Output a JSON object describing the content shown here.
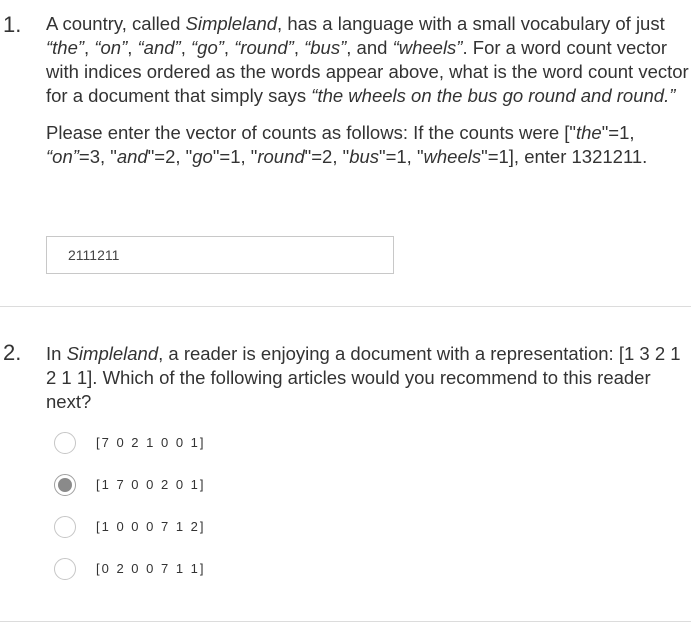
{
  "questions": [
    {
      "number": "1.",
      "prompt": {
        "t1": "A country, called ",
        "t2": "Simpleland",
        "t3": ", has a language with a small vocabulary of just ",
        "t4": "“the”",
        "t5": ", ",
        "t6": "“on”",
        "t7": ", ",
        "t8": "“and”",
        "t9": ", ",
        "t10": "“go”",
        "t11": ", ",
        "t12": "“round”",
        "t13": ", ",
        "t14": "“bus”",
        "t15": ", and ",
        "t16": "“wheels”",
        "t17": ". For a word count vector with indices ordered as the words appear above, what is the word count vector for a document that simply says ",
        "t18": "“the wheels on the bus go round and round.”"
      },
      "instructions": {
        "t1": "Please enter the vector of counts as follows: If the counts were [\"",
        "t2": "the",
        "t3": "\"=1, ",
        "t4": "“on”",
        "t5": "=3, \"",
        "t6": "and",
        "t7": "\"=2, \"",
        "t8": "go",
        "t9": "\"=1, \"",
        "t10": "round",
        "t11": "\"=2, \"",
        "t12": "bus",
        "t13": "\"=1, \"",
        "t14": "wheels",
        "t15": "\"=1], enter 1321211."
      },
      "answer_value": "2111211"
    },
    {
      "number": "2.",
      "prompt": {
        "t1": "In ",
        "t2": "Simpleland",
        "t3": ", a reader is enjoying a document with a representation: [1 3 2 1 2 1 1]. Which of the following articles would you recommend to this reader next?"
      },
      "options": [
        {
          "label": "[7 0 2 1 0 0 1]",
          "selected": false
        },
        {
          "label": "[1 7 0 0 2 0 1]",
          "selected": true
        },
        {
          "label": "[1 0 0 0 7 1 2]",
          "selected": false
        },
        {
          "label": "[0 2 0 0 7 1 1]",
          "selected": false
        }
      ]
    }
  ]
}
